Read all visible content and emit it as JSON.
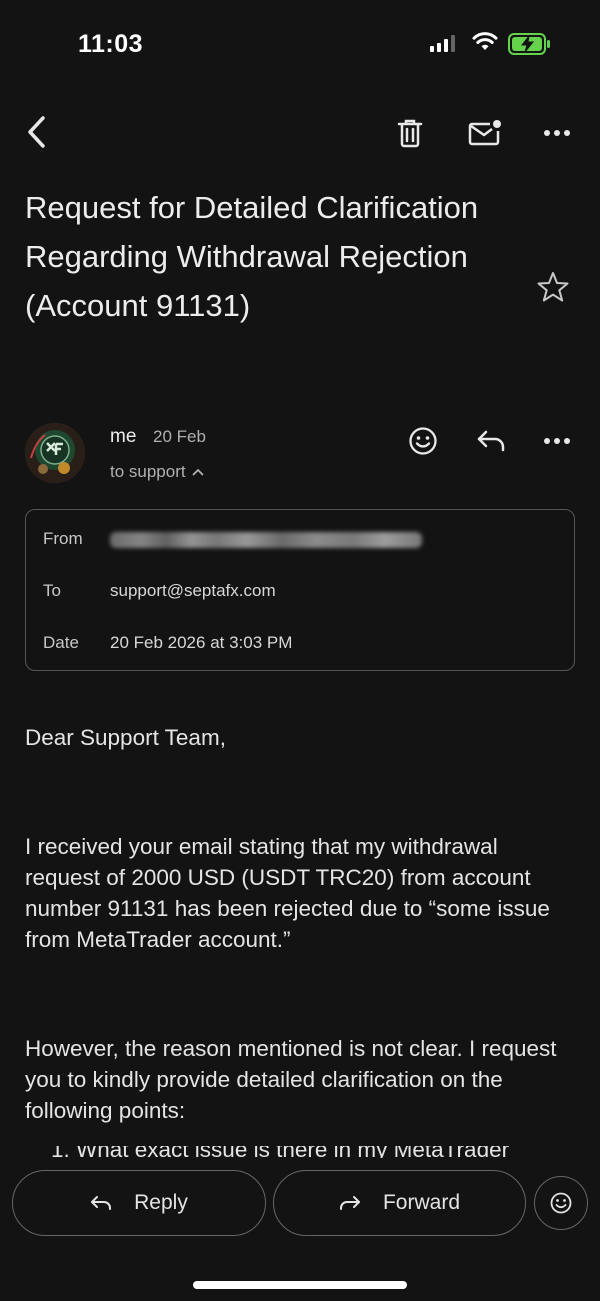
{
  "status_bar": {
    "time": "11:03"
  },
  "toolbar": {
    "back_icon": "chevron-left-icon",
    "delete_icon": "trash-icon",
    "unread_icon": "mark-unread-icon",
    "more_icon": "more-horizontal-icon"
  },
  "subject": "Request for Detailed Clarification Regarding Withdrawal Rejection (Account 91131)",
  "message": {
    "sender": "me",
    "date": "20 Feb",
    "to_line": "to support"
  },
  "details": {
    "from_label": "From",
    "to_label": "To",
    "to_value": "support@septafx.com",
    "date_label": "Date",
    "date_value": "20 Feb 2026 at 3:03 PM"
  },
  "body": {
    "greeting": "Dear Support Team,",
    "paragraph1": "I received your email stating that my withdrawal request of 2000 USD (USDT TRC20) from account number 91131 has been rejected due to “some issue from MetaTrader account.”",
    "paragraph2": "However, the reason mentioned is not clear. I request you to kindly provide detailed clarification on the following points:",
    "list_item_1_partial": "1.  What exact issue is there in my MetaTrader"
  },
  "bottom_bar": {
    "reply_label": "Reply",
    "forward_label": "Forward"
  },
  "colors": {
    "background": "#131313",
    "text": "#e8e8e8",
    "secondary_text": "#b0b0b0",
    "battery_green": "#65d34b"
  }
}
